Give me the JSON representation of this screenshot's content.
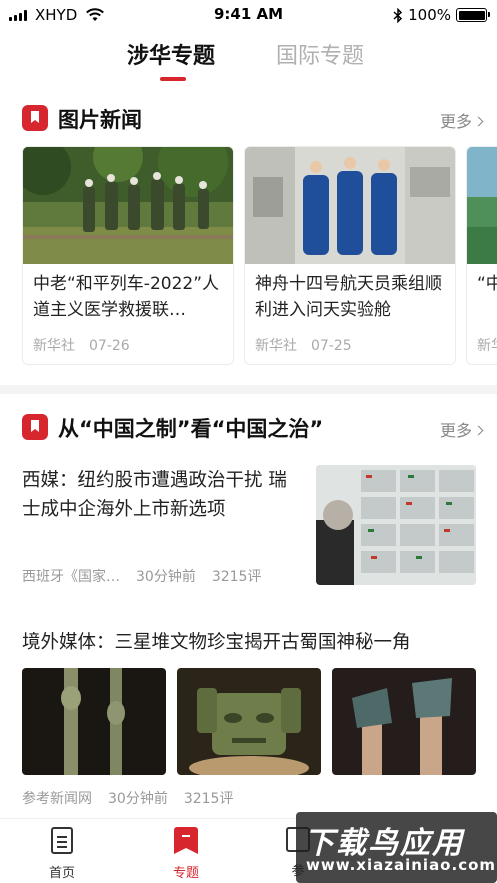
{
  "status_bar": {
    "carrier": "XHYD",
    "time": "9:41 AM",
    "battery": "100%"
  },
  "top_tabs": [
    {
      "label": "涉华专题",
      "active": true
    },
    {
      "label": "国际专题",
      "active": false
    }
  ],
  "sections": [
    {
      "title": "图片新闻",
      "more": "更多"
    },
    {
      "title": "从“中国之制”看“中国之治”",
      "more": "更多"
    }
  ],
  "photo_cards": [
    {
      "title": "中老“和平列车-2022”人道主义医学救援联…",
      "source": "新华社",
      "date": "07-26"
    },
    {
      "title": "神舟十四号航天员乘组顺利进入问天实验舱",
      "source": "新华社",
      "date": "07-25"
    },
    {
      "title": "“中发",
      "source": "新华",
      "date": ""
    }
  ],
  "articles": [
    {
      "title": "西媒：纽约股市遭遇政治干扰 瑞士成中企海外上市新选项",
      "source": "西班牙《国家…",
      "time": "30分钟前",
      "comments": "3215评"
    },
    {
      "title": "境外媒体：三星堆文物珍宝揭开古蜀国神秘一角",
      "source": "参考新闻网",
      "time": "30分钟前",
      "comments": "3215评"
    }
  ],
  "bottom_nav": [
    {
      "label": "首页",
      "icon": "document-icon",
      "active": false
    },
    {
      "label": "专题",
      "icon": "bookmark-icon",
      "active": true
    },
    {
      "label": "参",
      "icon": "book-icon",
      "active": false
    }
  ],
  "watermark": {
    "line1": "下载鸟应用",
    "line2": "www.xiazainiao.com"
  },
  "colors": {
    "accent": "#d8262f",
    "muted": "#999999",
    "divider": "#f3f3f3"
  }
}
